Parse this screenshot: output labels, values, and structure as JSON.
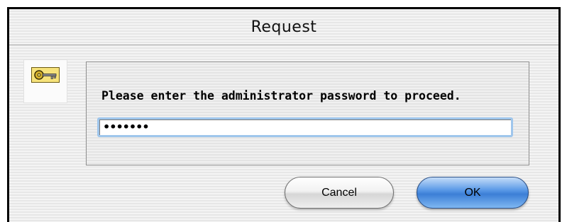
{
  "dialog": {
    "title": "Request",
    "message": "Please enter the administrator password to proceed.",
    "password_value": "•••••••",
    "icon": "key-icon"
  },
  "buttons": {
    "cancel_label": "Cancel",
    "ok_label": "OK"
  },
  "colors": {
    "default_button": "#3c7fd6",
    "focus_ring": "#9fc6ec"
  }
}
